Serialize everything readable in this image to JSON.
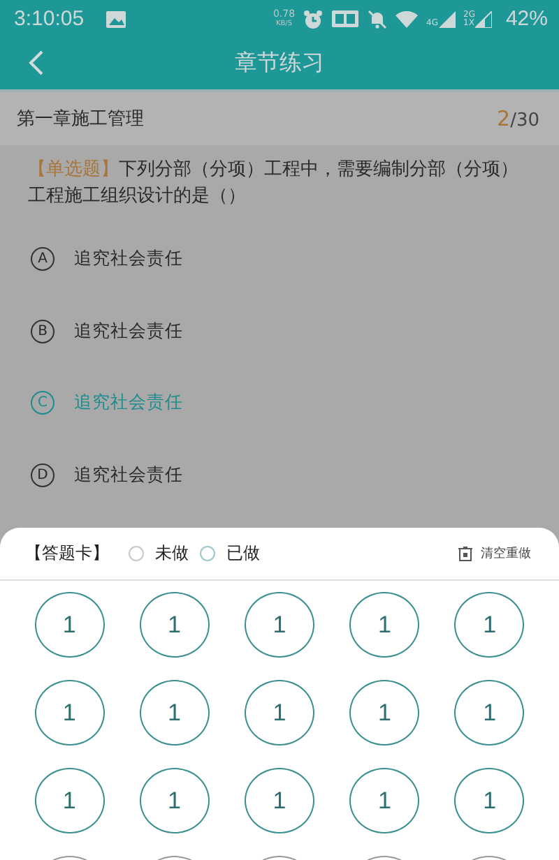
{
  "status_bar": {
    "time": "3:10:05",
    "speed_value": "0.78",
    "speed_unit": "KB/S",
    "network_1": "4G",
    "network_2_top": "2G",
    "network_2_bottom": "1X",
    "battery": "42%"
  },
  "title_bar": {
    "title": "章节练习"
  },
  "chapter": {
    "name": "第一章施工管理",
    "current": "2",
    "total": "/30"
  },
  "question": {
    "type": "【单选题】",
    "text": "下列分部（分项）工程中，需要编制分部（分项）工程施工组织设计的是（）"
  },
  "options": [
    {
      "letter": "A",
      "text": "追究社会责任",
      "selected": false
    },
    {
      "letter": "B",
      "text": "追究社会责任",
      "selected": false
    },
    {
      "letter": "C",
      "text": "追究社会责任",
      "selected": true
    },
    {
      "letter": "D",
      "text": "追究社会责任",
      "selected": false
    }
  ],
  "answer_card": {
    "title": "【答题卡】",
    "legend": [
      {
        "label": "未做",
        "color": "#c8c8c8"
      },
      {
        "label": "已做",
        "color": "#9cc8c8"
      }
    ],
    "clear_button": "清空重做",
    "items": [
      {
        "kind": "number",
        "label": "1"
      },
      {
        "kind": "number",
        "label": "1"
      },
      {
        "kind": "number",
        "label": "1"
      },
      {
        "kind": "number",
        "label": "1"
      },
      {
        "kind": "number",
        "label": "1"
      },
      {
        "kind": "number",
        "label": "1"
      },
      {
        "kind": "number",
        "label": "1"
      },
      {
        "kind": "number",
        "label": "1"
      },
      {
        "kind": "number",
        "label": "1"
      },
      {
        "kind": "number",
        "label": "1"
      },
      {
        "kind": "number",
        "label": "1"
      },
      {
        "kind": "number",
        "label": "1"
      },
      {
        "kind": "number",
        "label": "1"
      },
      {
        "kind": "number",
        "label": "1"
      },
      {
        "kind": "number",
        "label": "1"
      },
      {
        "kind": "cut"
      },
      {
        "kind": "cut"
      },
      {
        "kind": "cut"
      },
      {
        "kind": "cut"
      },
      {
        "kind": "cut"
      }
    ]
  }
}
